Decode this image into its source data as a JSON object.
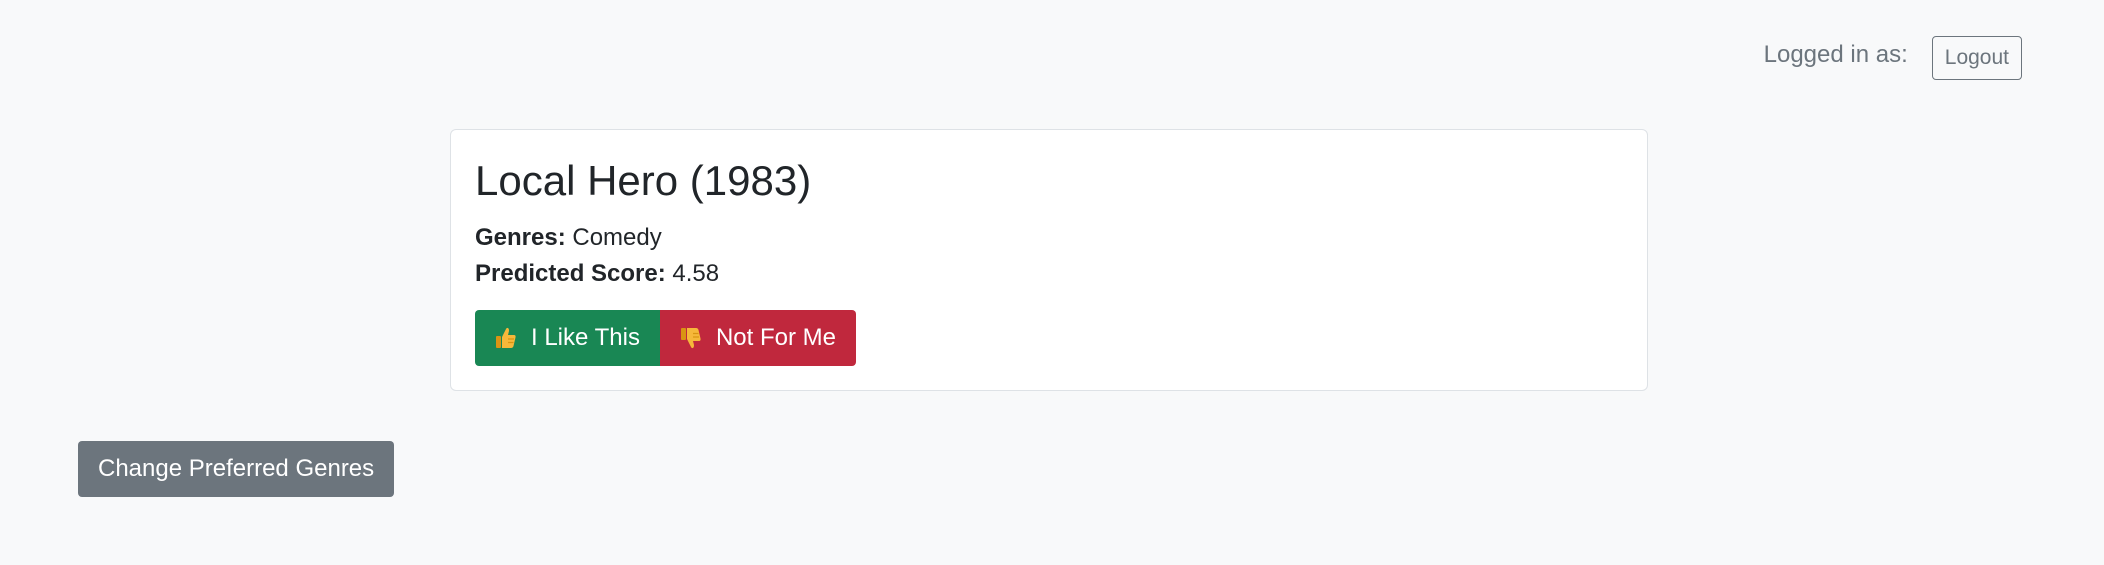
{
  "header": {
    "logged_in_label": "Logged in as:",
    "logout_label": "Logout"
  },
  "movie": {
    "title": "Local Hero (1983)",
    "genres_label": "Genres:",
    "genres_value": "Comedy",
    "score_label": "Predicted Score:",
    "score_value": "4.58",
    "like_label": "I Like This",
    "dislike_label": "Not For Me",
    "like_icon": "thumbs-up-icon",
    "dislike_icon": "thumbs-down-icon"
  },
  "actions": {
    "change_genres_label": "Change Preferred Genres"
  },
  "colors": {
    "success": "#198754",
    "danger": "#c0283d",
    "secondary": "#6c757d",
    "emoji_yellow": "#f6b83a"
  }
}
